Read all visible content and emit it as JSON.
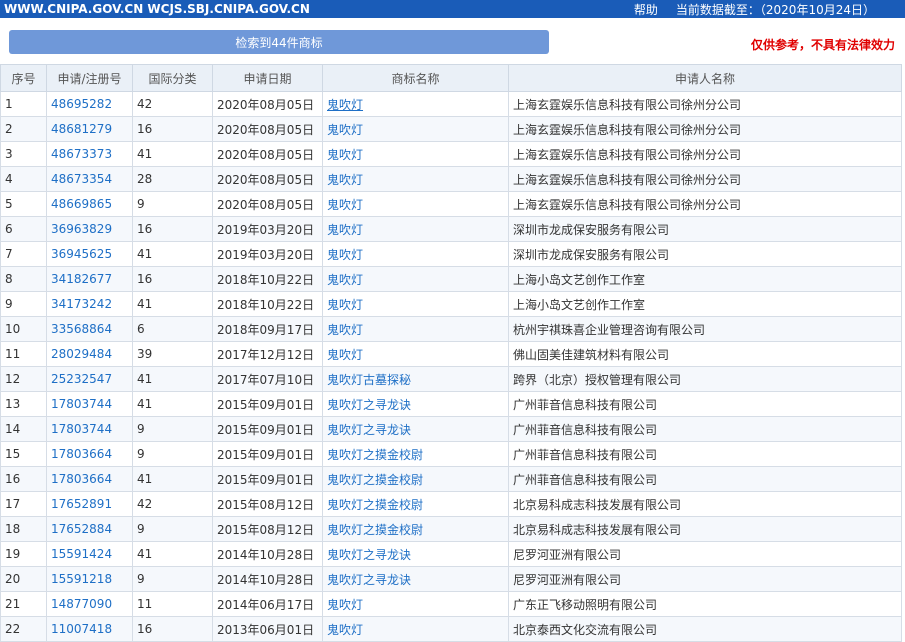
{
  "header": {
    "site": "WWW.CNIPA.GOV.CN WCJS.SBJ.CNIPA.GOV.CN",
    "help": "帮助",
    "data_date": "当前数据截至：（2020年10月24日）"
  },
  "result_label": "检索到44件商标",
  "disclaimer": "仅供参考，不具有法律效力",
  "columns": [
    "序号",
    "申请/注册号",
    "国际分类",
    "申请日期",
    "商标名称",
    "申请人名称"
  ],
  "rows": [
    {
      "idx": "1",
      "reg": "48695282",
      "cls": "42",
      "date": "2020年08月05日",
      "mark": "鬼吹灯",
      "applicant": "上海玄霆娱乐信息科技有限公司徐州分公司"
    },
    {
      "idx": "2",
      "reg": "48681279",
      "cls": "16",
      "date": "2020年08月05日",
      "mark": "鬼吹灯",
      "applicant": "上海玄霆娱乐信息科技有限公司徐州分公司"
    },
    {
      "idx": "3",
      "reg": "48673373",
      "cls": "41",
      "date": "2020年08月05日",
      "mark": "鬼吹灯",
      "applicant": "上海玄霆娱乐信息科技有限公司徐州分公司"
    },
    {
      "idx": "4",
      "reg": "48673354",
      "cls": "28",
      "date": "2020年08月05日",
      "mark": "鬼吹灯",
      "applicant": "上海玄霆娱乐信息科技有限公司徐州分公司"
    },
    {
      "idx": "5",
      "reg": "48669865",
      "cls": "9",
      "date": "2020年08月05日",
      "mark": "鬼吹灯",
      "applicant": "上海玄霆娱乐信息科技有限公司徐州分公司"
    },
    {
      "idx": "6",
      "reg": "36963829",
      "cls": "16",
      "date": "2019年03月20日",
      "mark": "鬼吹灯",
      "applicant": "深圳市龙成保安服务有限公司"
    },
    {
      "idx": "7",
      "reg": "36945625",
      "cls": "41",
      "date": "2019年03月20日",
      "mark": "鬼吹灯",
      "applicant": "深圳市龙成保安服务有限公司"
    },
    {
      "idx": "8",
      "reg": "34182677",
      "cls": "16",
      "date": "2018年10月22日",
      "mark": "鬼吹灯",
      "applicant": "上海小岛文艺创作工作室"
    },
    {
      "idx": "9",
      "reg": "34173242",
      "cls": "41",
      "date": "2018年10月22日",
      "mark": "鬼吹灯",
      "applicant": "上海小岛文艺创作工作室"
    },
    {
      "idx": "10",
      "reg": "33568864",
      "cls": "6",
      "date": "2018年09月17日",
      "mark": "鬼吹灯",
      "applicant": "杭州宇祺珠喜企业管理咨询有限公司"
    },
    {
      "idx": "11",
      "reg": "28029484",
      "cls": "39",
      "date": "2017年12月12日",
      "mark": "鬼吹灯",
      "applicant": "佛山固美佳建筑材料有限公司"
    },
    {
      "idx": "12",
      "reg": "25232547",
      "cls": "41",
      "date": "2017年07月10日",
      "mark": "鬼吹灯古墓探秘",
      "applicant": "跨界（北京）授权管理有限公司"
    },
    {
      "idx": "13",
      "reg": "17803744",
      "cls": "41",
      "date": "2015年09月01日",
      "mark": "鬼吹灯之寻龙诀",
      "applicant": "广州菲音信息科技有限公司"
    },
    {
      "idx": "14",
      "reg": "17803744",
      "cls": "9",
      "date": "2015年09月01日",
      "mark": "鬼吹灯之寻龙诀",
      "applicant": "广州菲音信息科技有限公司"
    },
    {
      "idx": "15",
      "reg": "17803664",
      "cls": "9",
      "date": "2015年09月01日",
      "mark": "鬼吹灯之摸金校尉",
      "applicant": "广州菲音信息科技有限公司"
    },
    {
      "idx": "16",
      "reg": "17803664",
      "cls": "41",
      "date": "2015年09月01日",
      "mark": "鬼吹灯之摸金校尉",
      "applicant": "广州菲音信息科技有限公司"
    },
    {
      "idx": "17",
      "reg": "17652891",
      "cls": "42",
      "date": "2015年08月12日",
      "mark": "鬼吹灯之摸金校尉",
      "applicant": "北京易科成志科技发展有限公司"
    },
    {
      "idx": "18",
      "reg": "17652884",
      "cls": "9",
      "date": "2015年08月12日",
      "mark": "鬼吹灯之摸金校尉",
      "applicant": "北京易科成志科技发展有限公司"
    },
    {
      "idx": "19",
      "reg": "15591424",
      "cls": "41",
      "date": "2014年10月28日",
      "mark": "鬼吹灯之寻龙诀",
      "applicant": "尼罗河亚洲有限公司"
    },
    {
      "idx": "20",
      "reg": "15591218",
      "cls": "9",
      "date": "2014年10月28日",
      "mark": "鬼吹灯之寻龙诀",
      "applicant": "尼罗河亚洲有限公司"
    },
    {
      "idx": "21",
      "reg": "14877090",
      "cls": "11",
      "date": "2014年06月17日",
      "mark": "鬼吹灯",
      "applicant": "广东正飞移动照明有限公司"
    },
    {
      "idx": "22",
      "reg": "11007418",
      "cls": "16",
      "date": "2013年06月01日",
      "mark": "鬼吹灯",
      "applicant": "北京泰西文化交流有限公司"
    }
  ]
}
